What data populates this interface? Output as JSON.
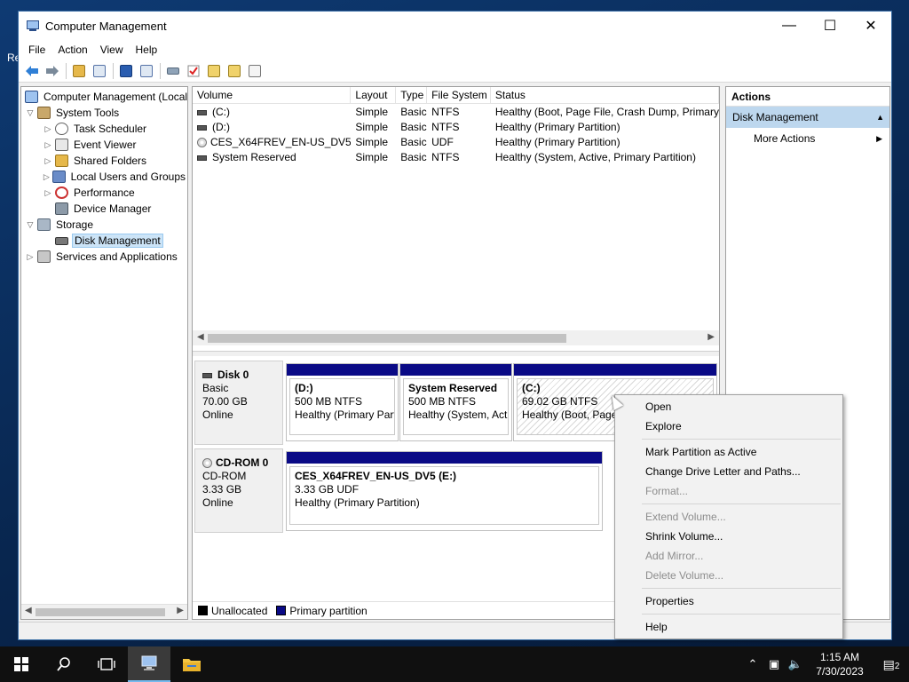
{
  "desktop": {
    "label": "Re"
  },
  "window": {
    "title": "Computer Management",
    "minimize": "—",
    "maximize": "☐",
    "close": "✕"
  },
  "menu": [
    "File",
    "Action",
    "View",
    "Help"
  ],
  "tree": {
    "root": "Computer Management (Local",
    "system_tools": "System Tools",
    "task_scheduler": "Task Scheduler",
    "event_viewer": "Event Viewer",
    "shared_folders": "Shared Folders",
    "local_users": "Local Users and Groups",
    "performance": "Performance",
    "device_manager": "Device Manager",
    "storage": "Storage",
    "disk_management": "Disk Management",
    "services": "Services and Applications"
  },
  "volumes": {
    "headers": [
      "Volume",
      "Layout",
      "Type",
      "File System",
      "Status"
    ],
    "rows": [
      {
        "volume": "(C:)",
        "layout": "Simple",
        "type": "Basic",
        "fs": "NTFS",
        "status": "Healthy (Boot, Page File, Crash Dump, Primary P"
      },
      {
        "volume": "(D:)",
        "layout": "Simple",
        "type": "Basic",
        "fs": "NTFS",
        "status": "Healthy (Primary Partition)"
      },
      {
        "volume": "CES_X64FREV_EN-US_DV5 (E:)",
        "layout": "Simple",
        "type": "Basic",
        "fs": "UDF",
        "status": "Healthy (Primary Partition)"
      },
      {
        "volume": "System Reserved",
        "layout": "Simple",
        "type": "Basic",
        "fs": "NTFS",
        "status": "Healthy (System, Active, Primary Partition)"
      }
    ]
  },
  "disks": {
    "disk0": {
      "name": "Disk 0",
      "kind": "Basic",
      "size": "70.00 GB",
      "state": "Online",
      "partitions": [
        {
          "name": "(D:)",
          "size": "500 MB NTFS",
          "status": "Healthy (Primary Part"
        },
        {
          "name": "System Reserved",
          "size": "500 MB NTFS",
          "status": "Healthy (System, Acti"
        },
        {
          "name": "(C:)",
          "size": "69.02 GB NTFS",
          "status": "Healthy (Boot, Page"
        }
      ]
    },
    "cdrom0": {
      "name": "CD-ROM 0",
      "kind": "CD-ROM",
      "size": "3.33 GB",
      "state": "Online",
      "partition": {
        "name": "CES_X64FREV_EN-US_DV5  (E:)",
        "size": "3.33 GB UDF",
        "status": "Healthy (Primary Partition)"
      }
    }
  },
  "legend": {
    "unallocated": "Unallocated",
    "primary": "Primary partition",
    "unallocated_color": "#000000",
    "primary_color": "#0a0a86"
  },
  "actions": {
    "header": "Actions",
    "section": "Disk Management",
    "more": "More Actions"
  },
  "context_menu": {
    "open": "Open",
    "explore": "Explore",
    "mark_active": "Mark Partition as Active",
    "change_letter": "Change Drive Letter and Paths...",
    "format": "Format...",
    "extend": "Extend Volume...",
    "shrink": "Shrink Volume...",
    "add_mirror": "Add Mirror...",
    "delete": "Delete Volume...",
    "properties": "Properties",
    "help": "Help"
  },
  "taskbar": {
    "time": "1:15 AM",
    "date": "7/30/2023",
    "notifications": "2"
  }
}
